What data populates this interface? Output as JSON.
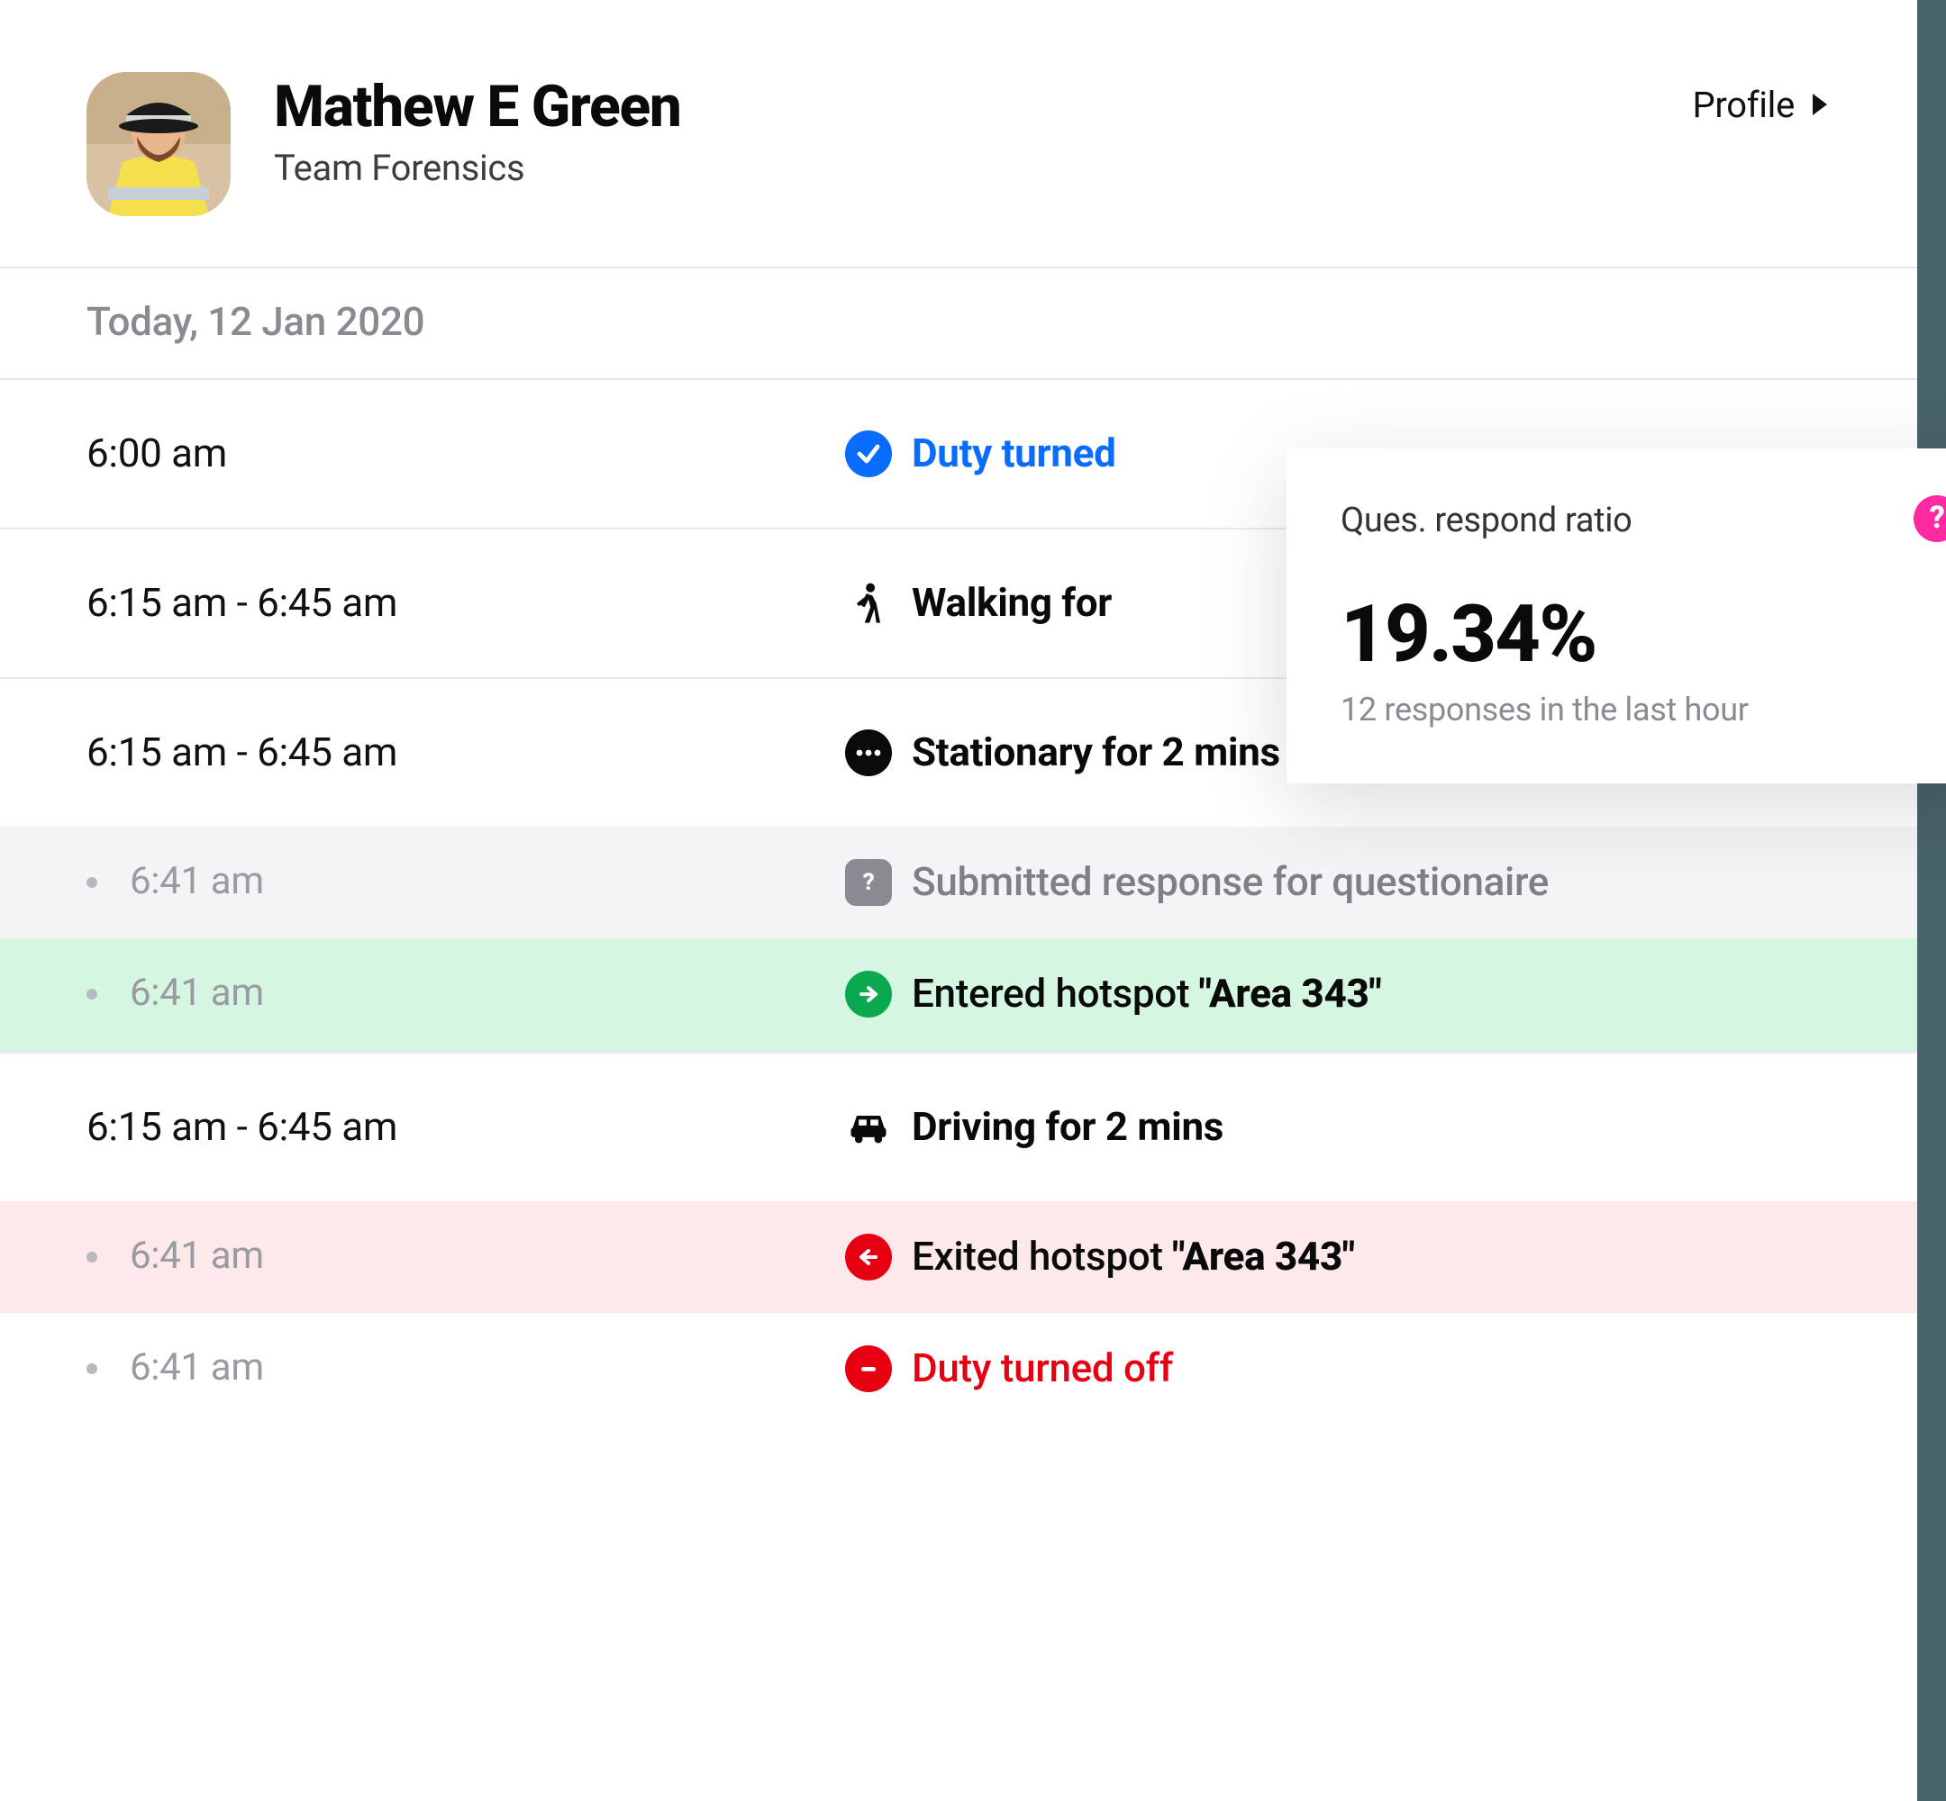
{
  "header": {
    "name": "Mathew E Green",
    "team": "Team Forensics",
    "profile_label": "Profile"
  },
  "date_label": "Today, 12 Jan 2020",
  "timeline": {
    "r0": {
      "time": "6:00 am",
      "label": "Duty turned"
    },
    "r1": {
      "time": "6:15 am - 6:45 am",
      "label": "Walking for"
    },
    "r2": {
      "time": "6:15 am - 6:45 am",
      "label": "Stationary for 2 mins"
    },
    "r3": {
      "time": "6:41 am",
      "label": "Submitted response for questionaire"
    },
    "r4": {
      "time": "6:41 am",
      "label_pre": "Entered hotspot ",
      "label_hot": "\"Area 343\""
    },
    "r5": {
      "time": "6:15 am - 6:45 am",
      "label": "Driving for 2 mins"
    },
    "r6": {
      "time": "6:41 am",
      "label_pre": "Exited hotspot ",
      "label_hot": "\"Area 343\""
    },
    "r7": {
      "time": "6:41 am",
      "label": "Duty turned off"
    }
  },
  "card": {
    "title": "Ques. respond ratio",
    "value": "19.34%",
    "note": "12 responses in the last hour"
  }
}
